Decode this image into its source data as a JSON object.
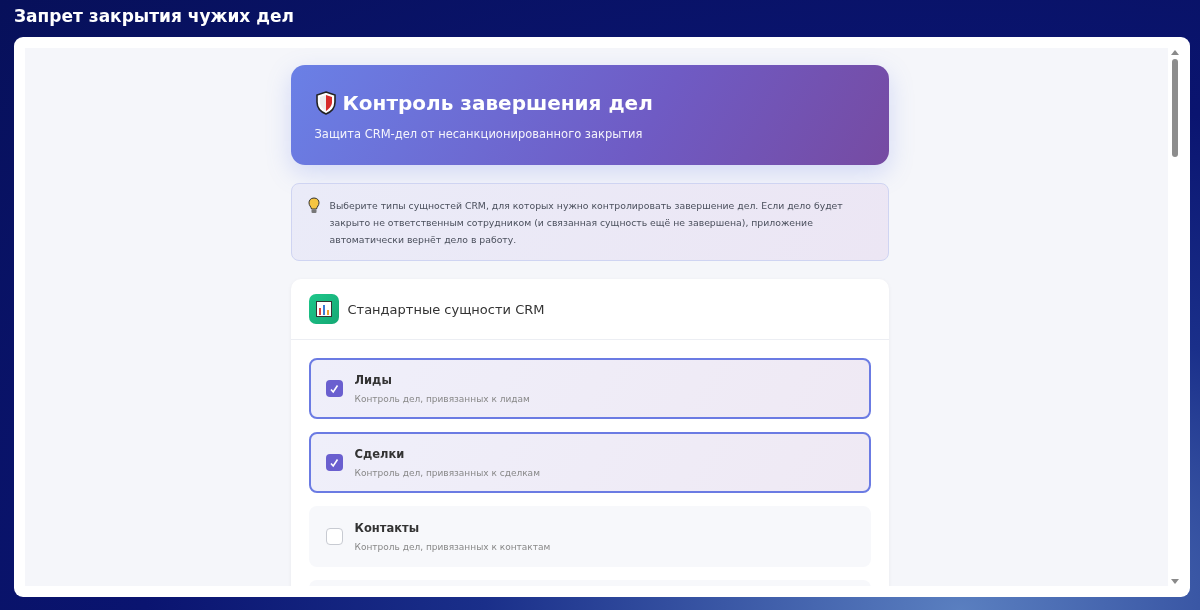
{
  "window": {
    "title": "Запрет закрытия чужих дел"
  },
  "header": {
    "title": "Контроль завершения дел",
    "subtitle": "Защита CRM-дел от несанкционированного закрытия"
  },
  "info": {
    "text": "Выберите типы сущностей CRM, для которых нужно контролировать завершение дел. Если дело будет закрыто не ответственным сотрудником (и связанная сущность ещё не завершена), приложение автоматически вернёт дело в работу."
  },
  "section": {
    "title": "Стандартные сущности CRM",
    "items": [
      {
        "label": "Лиды",
        "description": "Контроль дел, привязанных к лидам",
        "checked": true
      },
      {
        "label": "Сделки",
        "description": "Контроль дел, привязанных к сделкам",
        "checked": true
      },
      {
        "label": "Контакты",
        "description": "Контроль дел, привязанных к контактам",
        "checked": false
      }
    ]
  }
}
